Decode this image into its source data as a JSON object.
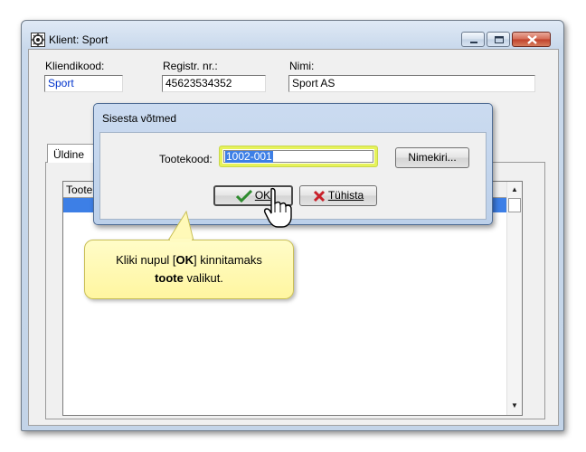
{
  "window": {
    "title": "Klient: Sport",
    "icon": "app-gear-icon"
  },
  "form": {
    "client_code_label": "Kliendikood:",
    "client_code_value": "Sport",
    "reg_nr_label": "Registr. nr.:",
    "reg_nr_value": "45623534352",
    "name_label": "Nimi:",
    "name_value": "Sport AS"
  },
  "tabs": [
    {
      "label": "Üldine"
    }
  ],
  "grid": {
    "columns": [
      "Toote"
    ]
  },
  "dialog": {
    "title": "Sisesta võtmed",
    "product_code_label": "Tootekood:",
    "product_code_value": "1002-001",
    "list_button": "Nimekiri...",
    "ok_button_label": "OK",
    "cancel_button_label": "Tühista"
  },
  "callout": {
    "text_1": "Kliki nupul [",
    "text_bold_1": "OK",
    "text_2": "] kinnitamaks",
    "text_bold_2": "toote",
    "text_3": " valikut."
  },
  "colors": {
    "selection": "#3d7fe6",
    "highlight_border": "#e6f25a",
    "callout_bg": "#fff6a0",
    "ok_check": "#2e8b2e",
    "cancel_x": "#c8202a"
  }
}
